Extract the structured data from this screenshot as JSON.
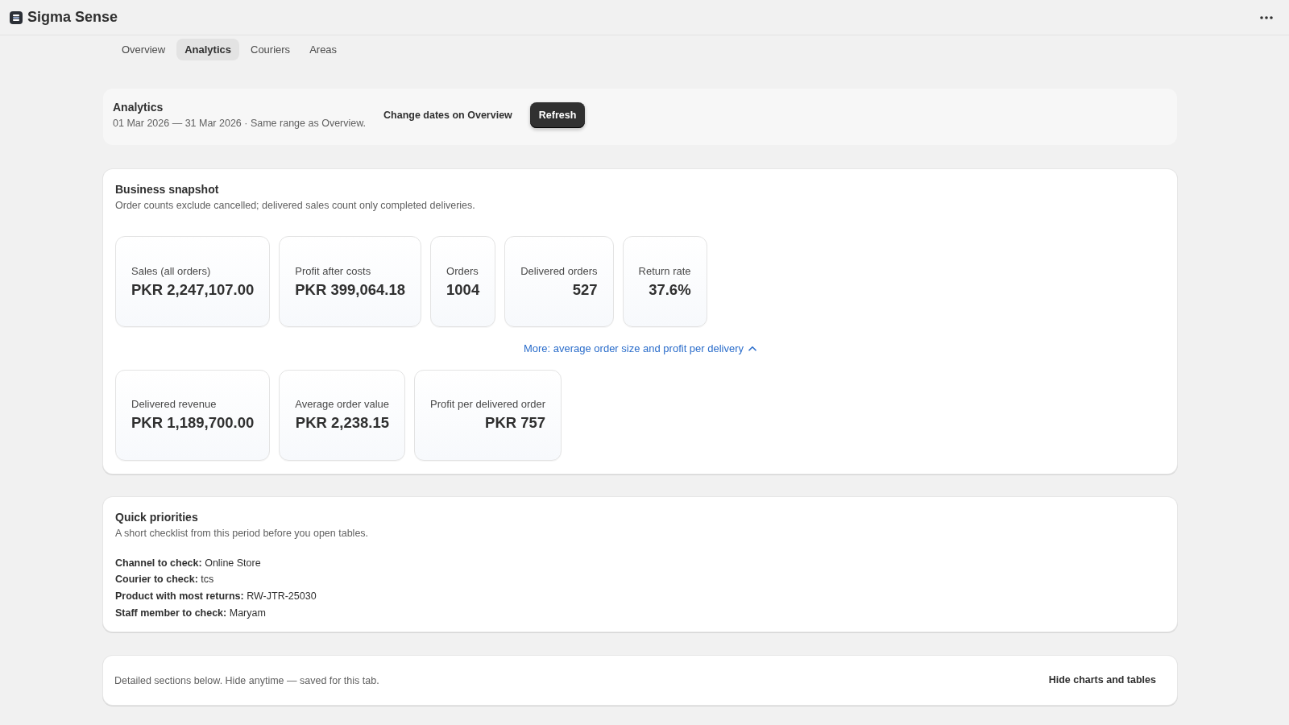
{
  "app": {
    "title": "Sigma Sense"
  },
  "tabs": [
    {
      "label": "Overview",
      "selected": false
    },
    {
      "label": "Analytics",
      "selected": true
    },
    {
      "label": "Couriers",
      "selected": false
    },
    {
      "label": "Areas",
      "selected": false
    }
  ],
  "header": {
    "title": "Analytics",
    "subtitle": "01 Mar 2026 — 31 Mar 2026 · Same range as Overview.",
    "link": "Change dates on Overview",
    "button": "Refresh"
  },
  "snapshot": {
    "title": "Business snapshot",
    "description": "Order counts exclude cancelled; delivered sales count only completed deliveries.",
    "metrics": [
      {
        "label": "Sales (all orders)",
        "value": "PKR 2,247,107.00"
      },
      {
        "label": "Profit after costs",
        "value": "PKR 399,064.18"
      },
      {
        "label": "Orders",
        "value": "1004"
      },
      {
        "label": "Delivered orders",
        "value": "527"
      },
      {
        "label": "Return rate",
        "value": "37.6%"
      }
    ],
    "toggle": {
      "label": "More: average order size and profit per delivery",
      "expanded": true
    },
    "more_metrics": [
      {
        "label": "Delivered revenue",
        "value": "PKR 1,189,700.00"
      },
      {
        "label": "Average order value",
        "value": "PKR 2,238.15"
      },
      {
        "label": "Profit per delivered order",
        "value": "PKR 757"
      }
    ]
  },
  "priorities": {
    "title": "Quick priorities",
    "description": "A short checklist from this period before you open tables.",
    "items": [
      {
        "label": "Channel to check:",
        "value": "Online Store"
      },
      {
        "label": "Courier to check:",
        "value": "tcs"
      },
      {
        "label": "Product with most returns:",
        "value": "RW-JTR-25030"
      },
      {
        "label": "Staff member to check:",
        "value": "Maryam"
      }
    ]
  },
  "details": {
    "text": "Detailed sections below. Hide anytime — saved for this tab.",
    "button": "Hide charts and tables"
  }
}
